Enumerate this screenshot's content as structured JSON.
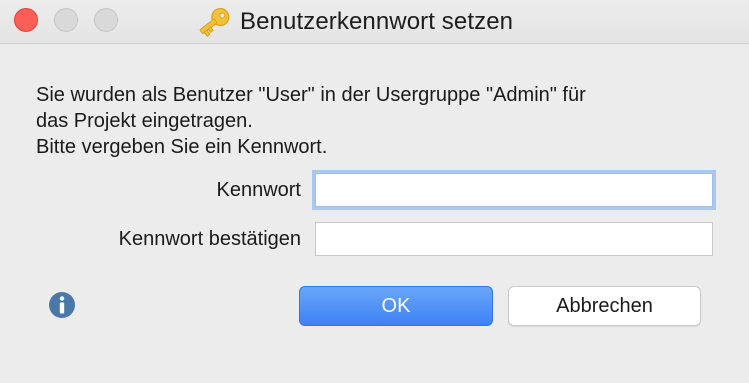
{
  "window": {
    "title": "Benutzerkennwort setzen",
    "title_icon": "key-icon"
  },
  "message": {
    "line1": "Sie wurden als Benutzer \"User\" in der Usergruppe \"Admin\" für",
    "line2": "das Projekt eingetragen.",
    "line3": "Bitte vergeben Sie ein Kennwort."
  },
  "form": {
    "password_label": "Kennwort",
    "password_value": "",
    "confirm_label": "Kennwort bestätigen",
    "confirm_value": ""
  },
  "buttons": {
    "ok_label": "OK",
    "cancel_label": "Abbrechen"
  },
  "icons": {
    "info": "info-icon"
  },
  "colors": {
    "close": "#fc5f57",
    "primary_button": "#3d82f5",
    "info_icon": "#4a78a8",
    "key_icon": "#f2c13c"
  }
}
